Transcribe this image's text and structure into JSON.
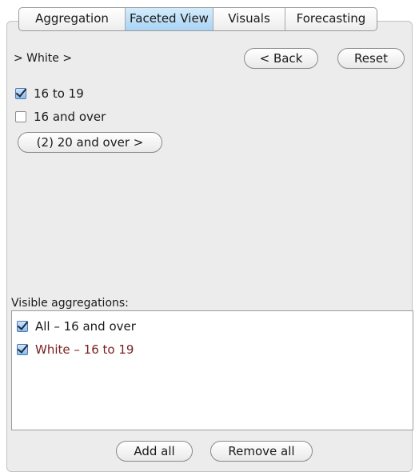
{
  "tabs": [
    {
      "label": "Aggregation",
      "active": false
    },
    {
      "label": "Faceted View",
      "active": true
    },
    {
      "label": "Visuals",
      "active": false
    },
    {
      "label": "Forecasting",
      "active": false
    }
  ],
  "breadcrumb": "> White >",
  "buttons": {
    "back": "< Back",
    "reset": "Reset",
    "drilldown": "(2) 20 and over >",
    "add_all": "Add all",
    "remove_all": "Remove all"
  },
  "facet_options": [
    {
      "label": "16 to 19",
      "checked": true
    },
    {
      "label": "16 and over",
      "checked": false
    }
  ],
  "visible_aggregations": {
    "label": "Visible aggregations:",
    "items": [
      {
        "label": "All – 16 and over",
        "checked": true,
        "color": "#1a1a1a"
      },
      {
        "label": "White – 16 to 19",
        "checked": true,
        "color": "#7a1f1f"
      }
    ]
  },
  "colors": {
    "active_tab": "#a9d3f4",
    "panel_bg": "#ececec",
    "highlight_item": "#7a1f1f"
  }
}
